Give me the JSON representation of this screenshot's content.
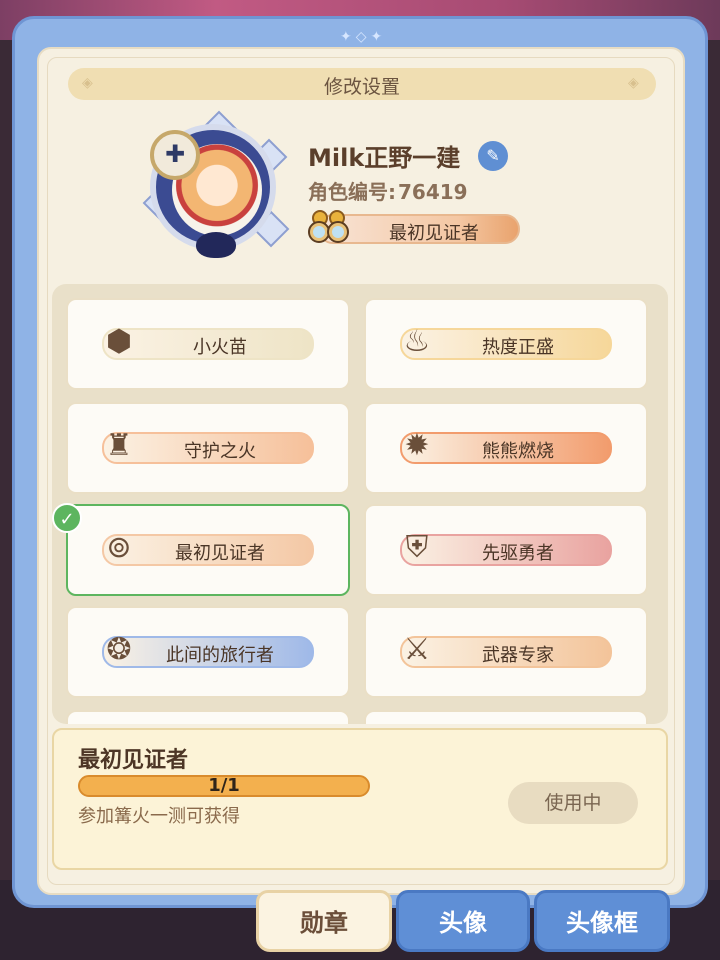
{
  "title": "修改设置",
  "profile": {
    "name": "Milk正野一建",
    "id_label": "角色编号:",
    "id_value": "76419",
    "badge": "最初见证者"
  },
  "badges": [
    {
      "label": "小火苗",
      "icon": "flame-hexagon-icon",
      "pill": "#eee4c6",
      "selected": false
    },
    {
      "label": "热度正盛",
      "icon": "flame-banner-icon",
      "pill": "#f6d79a",
      "selected": false
    },
    {
      "label": "守护之火",
      "icon": "guardian-flame-icon",
      "pill": "#f6c09a",
      "selected": false
    },
    {
      "label": "熊熊燃烧",
      "icon": "blazing-crest-icon",
      "pill": "#f29c6d",
      "selected": false
    },
    {
      "label": "最初见证者",
      "icon": "binoculars-icon",
      "pill": "#f4c8a5",
      "selected": true
    },
    {
      "label": "先驱勇者",
      "icon": "pioneer-shield-icon",
      "pill": "#e9a3a0",
      "selected": false
    },
    {
      "label": "此间的旅行者",
      "icon": "traveler-shell-icon",
      "pill": "#9fb9e8",
      "selected": false
    },
    {
      "label": "武器专家",
      "icon": "crossed-swords-icon",
      "pill": "#f3c49a",
      "selected": false
    }
  ],
  "detail": {
    "title": "最初见证者",
    "progress_text": "1/1",
    "progress": 1.0,
    "description": "参加篝火一测可获得",
    "button": "使用中"
  },
  "tabs": [
    {
      "label": "勋章",
      "active": true
    },
    {
      "label": "头像",
      "active": false
    },
    {
      "label": "头像框",
      "active": false
    }
  ],
  "colors": {
    "accent_green": "#5db55f",
    "tab_blue": "#5f8fd6",
    "progress_orange": "#f1a84a"
  }
}
